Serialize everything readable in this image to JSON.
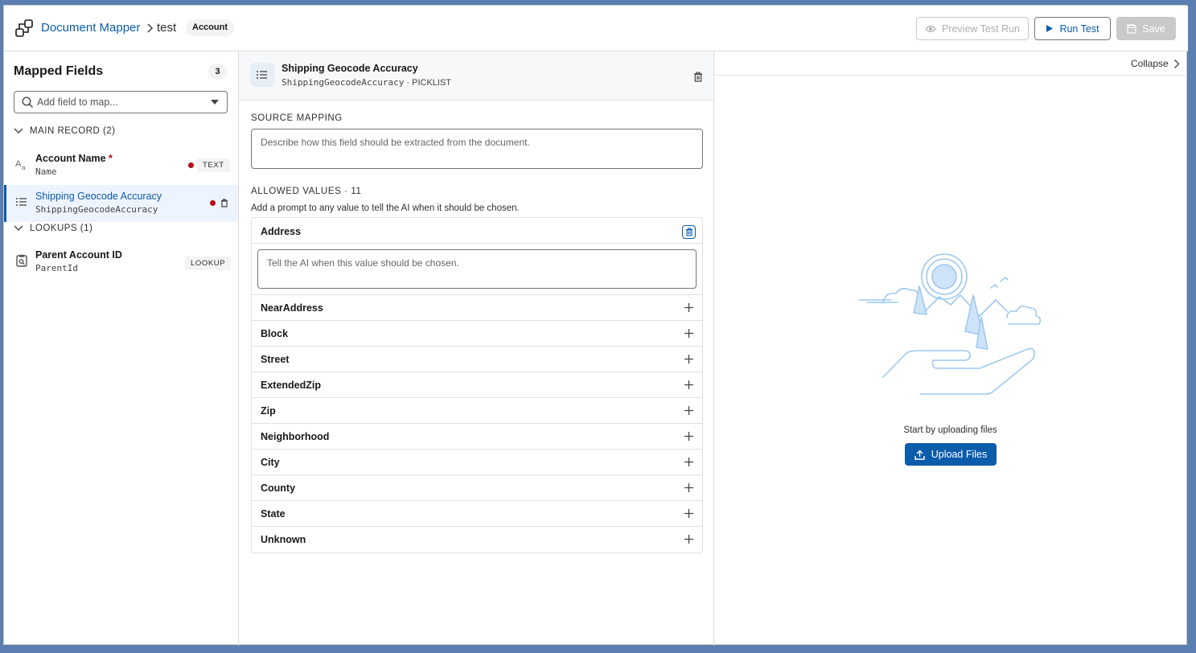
{
  "header": {
    "app_name": "Document Mapper",
    "record_name": "test",
    "object_badge": "Account",
    "preview_label": "Preview Test Run",
    "run_label": "Run Test",
    "save_label": "Save"
  },
  "sidebar": {
    "title": "Mapped Fields",
    "count": "3",
    "search_placeholder": "Add field to map...",
    "sections": [
      {
        "label": "MAIN RECORD (2)",
        "fields": [
          {
            "label": "Account Name",
            "required_mark": "*",
            "api_name": "Name",
            "type": "TEXT",
            "icon": "text-type-icon",
            "has_dot": true
          },
          {
            "label": "Shipping Geocode Accuracy",
            "api_name": "ShippingGeocodeAccuracy",
            "icon": "picklist-icon",
            "has_dot": true,
            "selected": true
          }
        ]
      },
      {
        "label": "LOOKUPS (1)",
        "fields": [
          {
            "label": "Parent Account ID",
            "api_name": "ParentId",
            "type": "LOOKUP",
            "icon": "lookup-icon"
          }
        ]
      }
    ]
  },
  "detail": {
    "title": "Shipping Geocode Accuracy",
    "subtitle_api": "ShippingGeocodeAccuracy",
    "subtitle_sep": " · ",
    "subtitle_type": "PICKLIST",
    "source_label": "SOURCE MAPPING",
    "source_placeholder": "Describe how this field should be extracted from the document.",
    "allowed_label": "ALLOWED VALUES · 11",
    "allowed_hint": "Add a prompt to any value to tell the AI when it should be chosen.",
    "expanded_value": "Address",
    "value_prompt_placeholder": "Tell the AI when this value should be chosen.",
    "values": [
      "NearAddress",
      "Block",
      "Street",
      "ExtendedZip",
      "Zip",
      "Neighborhood",
      "City",
      "County",
      "State",
      "Unknown"
    ]
  },
  "preview_panel": {
    "collapse_label": "Collapse",
    "empty_text": "Start by uploading files",
    "upload_label": "Upload Files"
  },
  "colors": {
    "brand": "#0b5cab",
    "required": "#ba0517",
    "illustration": "#9ec9f0"
  }
}
